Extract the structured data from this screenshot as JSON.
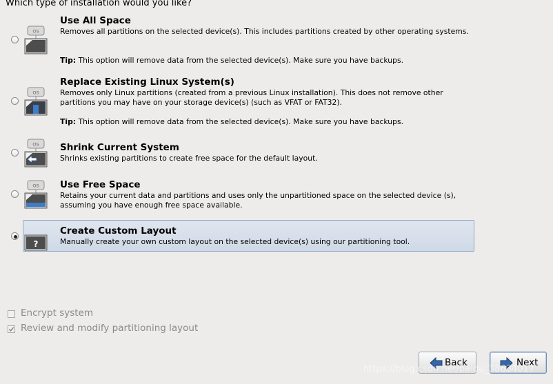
{
  "heading": "Which type of installation would you like?",
  "options": [
    {
      "title": "Use All Space",
      "desc": "Removes all partitions on the selected device(s).  This includes partitions created by other operating systems.",
      "tip_label": "Tip:",
      "tip_text": " This option will remove data from the selected device(s).  Make sure you have backups.",
      "icon": "disk-os-icon",
      "selected": false
    },
    {
      "title": "Replace Existing Linux System(s)",
      "desc": "Removes only Linux partitions (created from a previous Linux installation).  This does not remove other partitions you may have on your storage device(s) (such as VFAT or FAT32).",
      "tip_label": "Tip:",
      "tip_text": " This option will remove data from the selected device(s).  Make sure you have backups.",
      "icon": "disk-linux-icon",
      "selected": false
    },
    {
      "title": "Shrink Current System",
      "desc": "Shrinks existing partitions to create free space for the default layout.",
      "icon": "disk-shrink-icon",
      "selected": false
    },
    {
      "title": "Use Free Space",
      "desc": "Retains your current data and partitions and uses only the unpartitioned space on the selected device (s), assuming you have enough free space available.",
      "icon": "disk-free-icon",
      "selected": false
    },
    {
      "title": "Create Custom Layout",
      "desc": "Manually create your own custom layout on the selected device(s) using our partitioning tool.",
      "icon": "disk-custom-icon",
      "icon_glyph": "?",
      "selected": true
    }
  ],
  "os_badge": "OS",
  "checkboxes": [
    {
      "label": "Encrypt system",
      "checked": false
    },
    {
      "label": "Review and modify partitioning layout",
      "checked": true
    }
  ],
  "buttons": {
    "back": "Back",
    "next": "Next"
  },
  "watermark": "https://blog.csdn.net/baidu_38634017",
  "colors": {
    "background": "#edeceb",
    "selection": "#cfd9e6",
    "arrow": "#2f5f9e"
  }
}
